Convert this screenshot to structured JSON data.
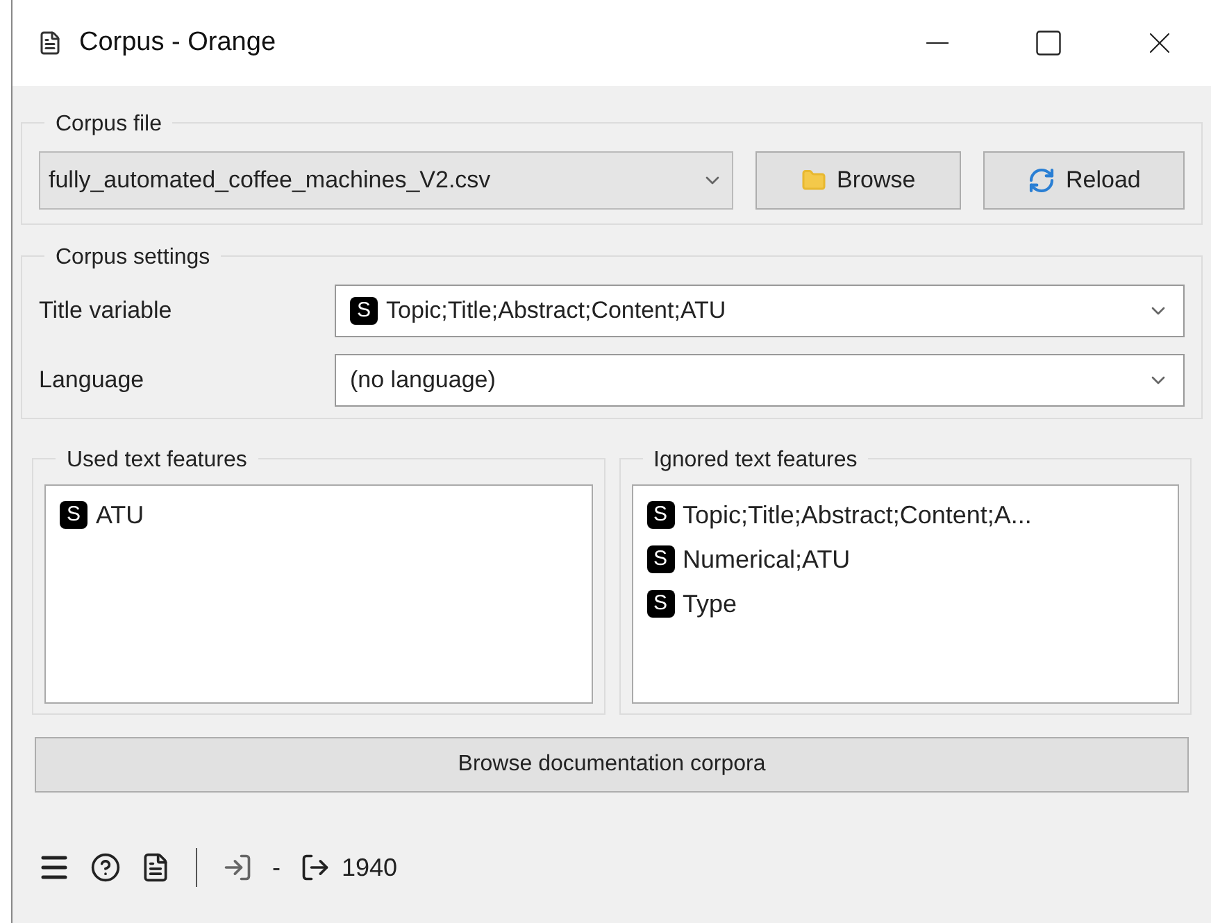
{
  "window": {
    "title": "Corpus - Orange"
  },
  "corpus_file": {
    "legend": "Corpus file",
    "file": "fully_automated_coffee_machines_V2.csv",
    "buttons": [
      {
        "kind": "browse",
        "label": "Browse"
      },
      {
        "kind": "reload",
        "label": "Reload"
      }
    ]
  },
  "corpus_settings": {
    "legend": "Corpus settings",
    "rows": [
      {
        "label": "Title variable",
        "badge": "S",
        "value": "Topic;Title;Abstract;Content;ATU"
      },
      {
        "label": "Language",
        "value": "(no language)"
      }
    ]
  },
  "used_text_features": {
    "legend": "Used text features",
    "items": [
      {
        "badge": "S",
        "label": "ATU"
      }
    ]
  },
  "ignored_text_features": {
    "legend": "Ignored text features",
    "items": [
      {
        "badge": "S",
        "label": "Topic;Title;Abstract;Content;A..."
      },
      {
        "badge": "S",
        "label": "Numerical;ATU"
      },
      {
        "badge": "S",
        "label": "Type"
      }
    ]
  },
  "documentation_button": "Browse documentation corpora",
  "status_bar": {
    "input": "-",
    "output": "1940"
  }
}
